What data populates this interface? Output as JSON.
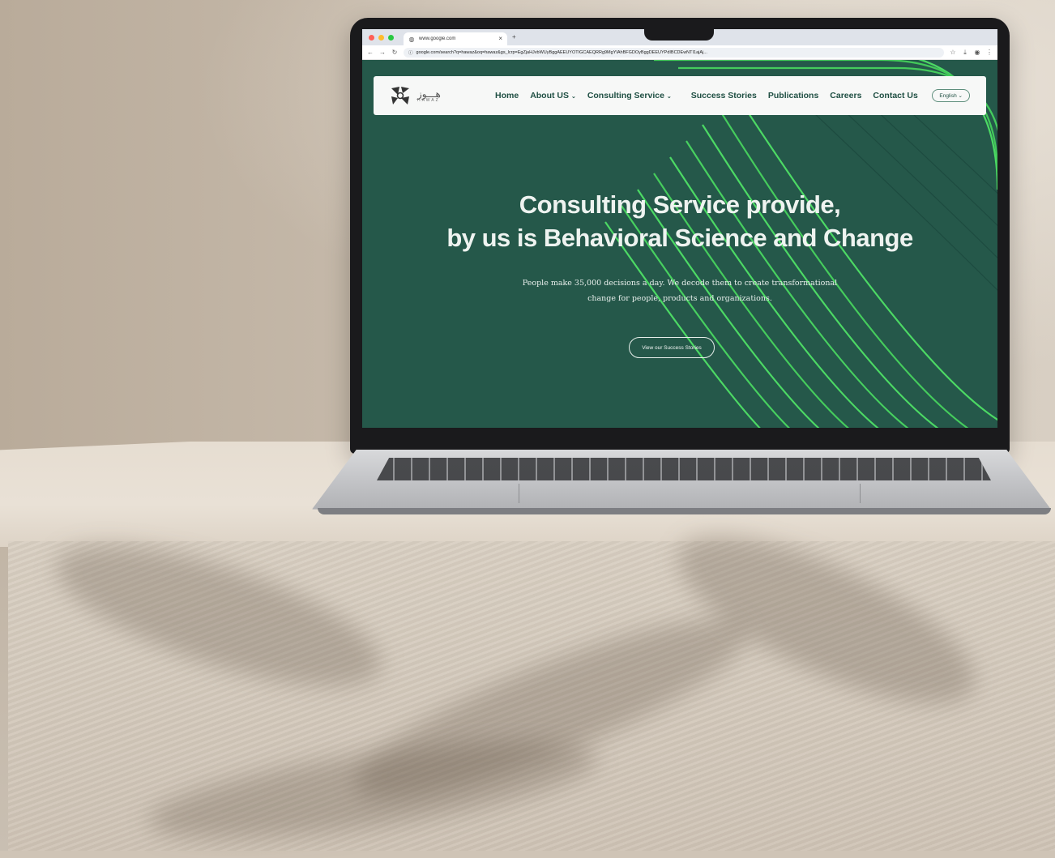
{
  "browser": {
    "tab_title": "www.google.com",
    "tab_close": "×",
    "new_tab": "+",
    "url": "google.com/search?q=hawaz&oq=hawaz&gs_lcrp=EgZjaHJvbWUyBggAEEUYOTIGCAEQRRg9MgYIAhBFGDOyBggDEEUYPdIBCDEwNTI1ajAj...",
    "icons": [
      "back-icon",
      "forward-icon",
      "reload-icon",
      "info-icon",
      "star-icon",
      "download-icon",
      "profile-icon",
      "menu-icon"
    ]
  },
  "site": {
    "logo": {
      "arabic": "هـــوز",
      "latin": "HAWAZ"
    },
    "nav": [
      {
        "label": "Home",
        "dropdown": false
      },
      {
        "label": "About US",
        "dropdown": true
      },
      {
        "label": "Consulting Service",
        "dropdown": true
      },
      {
        "label": "Success Stories",
        "dropdown": false
      },
      {
        "label": "Publications",
        "dropdown": false
      },
      {
        "label": "Careers",
        "dropdown": false
      },
      {
        "label": "Contact Us",
        "dropdown": false
      }
    ],
    "chevron": "⌄",
    "language": "English ⌄",
    "hero": {
      "title_line1": "Consulting Service provide,",
      "title_line2": "by us is Behavioral Science and Change",
      "subtitle_line1": "People make 35,000 decisions a day. We decode them to create transformational",
      "subtitle_line2": "change for people, products and organizations.",
      "cta": "View our Success Stories"
    }
  },
  "colors": {
    "page_bg": "#25584a",
    "accent_lines": "#4cd964",
    "nav_text": "#1f4f43",
    "navbar_bg": "#f7f8f7"
  }
}
